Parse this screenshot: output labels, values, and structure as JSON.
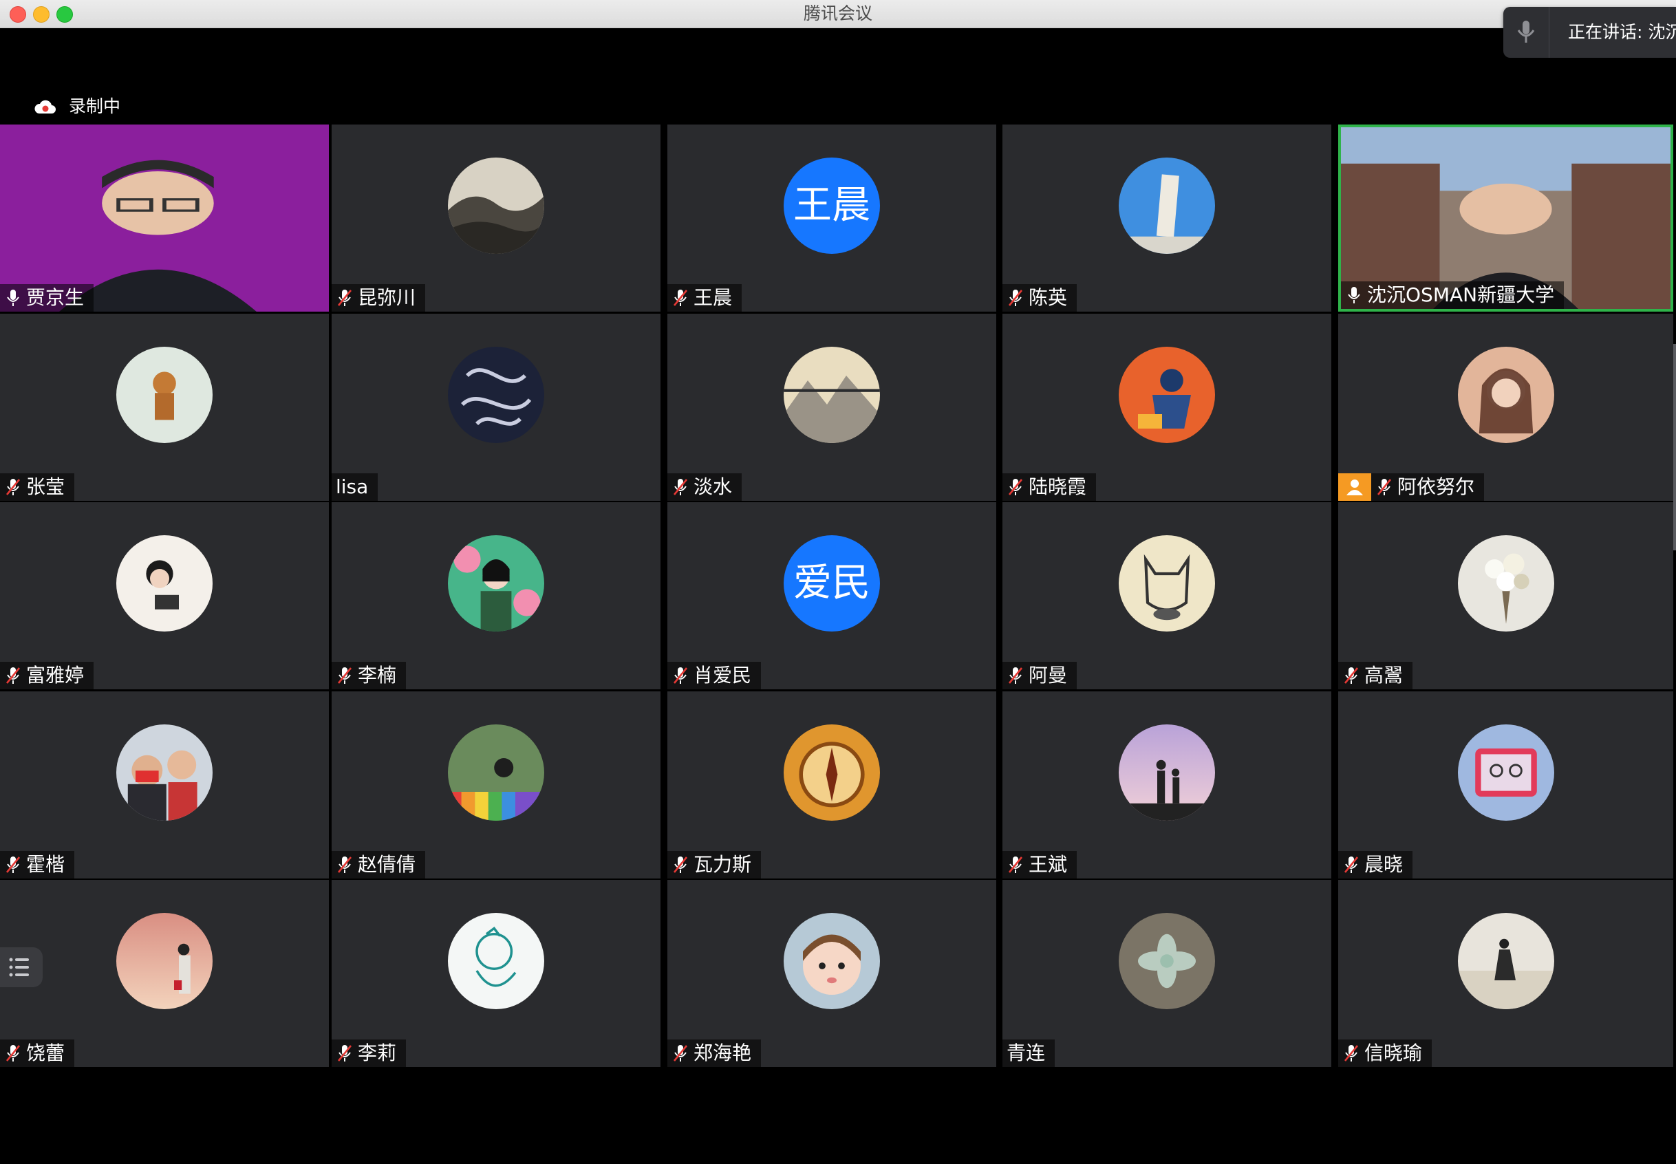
{
  "window": {
    "title": "腾讯会议"
  },
  "speaking": {
    "label": "正在讲话: 沈沉"
  },
  "recording": {
    "label": "录制中"
  },
  "participants": [
    {
      "name": "贾京生",
      "muted": false,
      "kind": "video",
      "avatar_icon": "video-speaker-with-glasses"
    },
    {
      "name": "昆弥川",
      "muted": true,
      "kind": "image",
      "avatar_icon": "ink-landscape-avatar"
    },
    {
      "name": "王晨",
      "muted": true,
      "kind": "text",
      "avatar_text": "王晨"
    },
    {
      "name": "陈英",
      "muted": true,
      "kind": "image",
      "avatar_icon": "leaning-tower-avatar"
    },
    {
      "name": "沈沉OSMAN新疆大学",
      "muted": false,
      "kind": "video",
      "avatar_icon": "video-speaker-campus"
    },
    {
      "name": "张莹",
      "muted": true,
      "kind": "image",
      "avatar_icon": "figurine-avatar"
    },
    {
      "name": "lisa",
      "muted": null,
      "kind": "image",
      "avatar_icon": "dragon-pattern-avatar"
    },
    {
      "name": "淡水",
      "muted": true,
      "kind": "image",
      "avatar_icon": "misty-mountain-avatar"
    },
    {
      "name": "陆晓霞",
      "muted": true,
      "kind": "image",
      "avatar_icon": "reading-girl-illustration-avatar"
    },
    {
      "name": "阿依努尔",
      "muted": true,
      "kind": "image",
      "avatar_icon": "woman-portrait-avatar",
      "host": true
    },
    {
      "name": "富雅婷",
      "muted": true,
      "kind": "image",
      "avatar_icon": "woman-with-camera-avatar"
    },
    {
      "name": "李楠",
      "muted": true,
      "kind": "image",
      "avatar_icon": "woman-leaves-illustration-avatar"
    },
    {
      "name": "肖爱民",
      "muted": true,
      "kind": "text",
      "avatar_text": "爱民"
    },
    {
      "name": "阿曼",
      "muted": true,
      "kind": "image",
      "avatar_icon": "batman-sketch-avatar"
    },
    {
      "name": "高翯",
      "muted": true,
      "kind": "image",
      "avatar_icon": "flower-bouquet-avatar"
    },
    {
      "name": "霍楷",
      "muted": true,
      "kind": "image",
      "avatar_icon": "two-men-selfie-avatar"
    },
    {
      "name": "赵倩倩",
      "muted": true,
      "kind": "image",
      "avatar_icon": "rainbow-stairs-avatar"
    },
    {
      "name": "瓦力斯",
      "muted": true,
      "kind": "image",
      "avatar_icon": "compass-avatar"
    },
    {
      "name": "王斌",
      "muted": true,
      "kind": "image",
      "avatar_icon": "parent-child-silhouette-avatar"
    },
    {
      "name": "晨晓",
      "muted": true,
      "kind": "image",
      "avatar_icon": "drawing-board-avatar"
    },
    {
      "name": "饶蕾",
      "muted": true,
      "kind": "image",
      "avatar_icon": "sunset-woman-avatar"
    },
    {
      "name": "李莉",
      "muted": true,
      "kind": "image",
      "avatar_icon": "line-drawing-avatar"
    },
    {
      "name": "郑海艳",
      "muted": true,
      "kind": "image",
      "avatar_icon": "child-face-avatar"
    },
    {
      "name": "青连",
      "muted": null,
      "kind": "image",
      "avatar_icon": "succulent-avatar"
    },
    {
      "name": "信晓瑜",
      "muted": true,
      "kind": "image",
      "avatar_icon": "desert-walker-avatar"
    }
  ],
  "colors": {
    "tile_bg": "#2a2b2e",
    "active_border": "#2fb34a",
    "text_avatar_bg": "#1677ff",
    "host_badge": "#f59a23"
  }
}
